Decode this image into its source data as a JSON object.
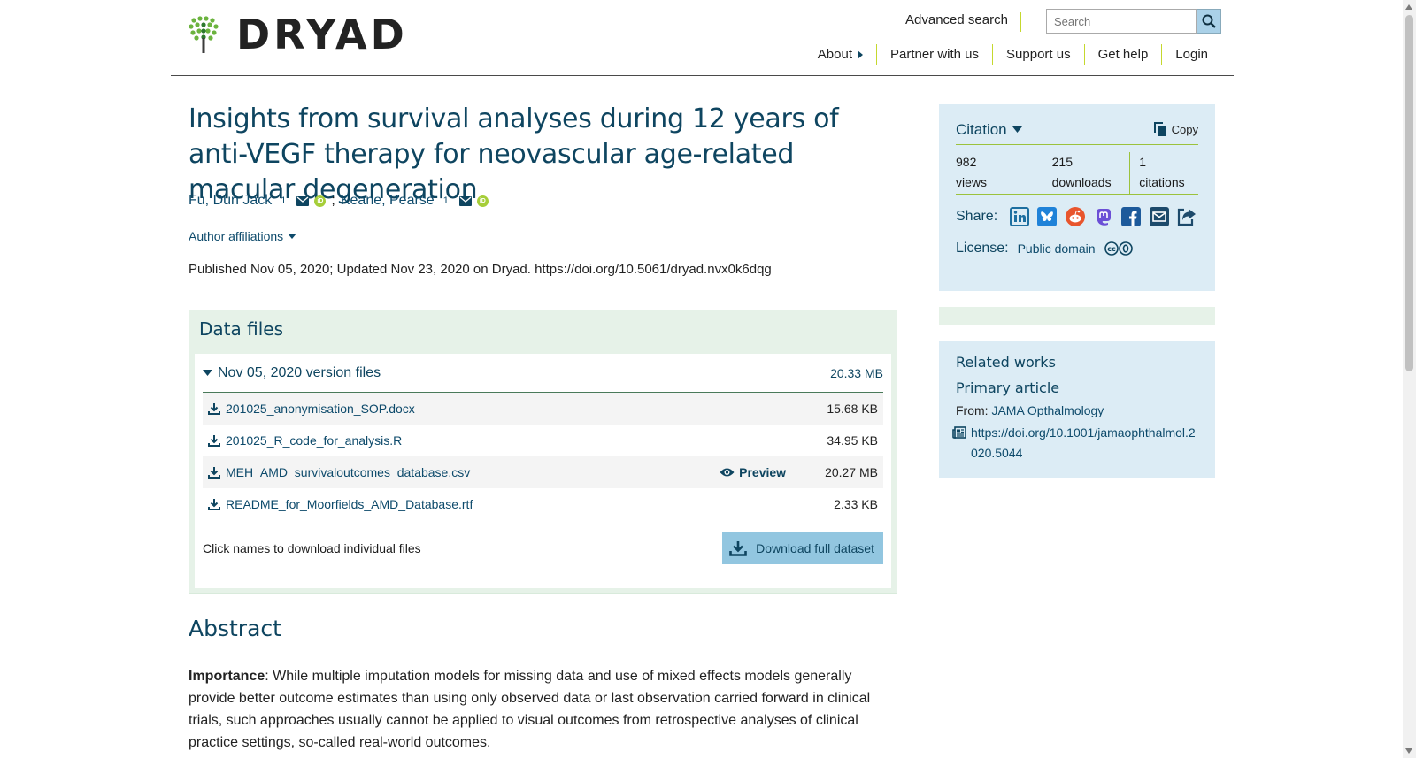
{
  "header": {
    "logo_text": "DRYAD",
    "advanced_search": "Advanced search",
    "search_placeholder": "Search",
    "nav": [
      "About",
      "Partner with us",
      "Support us",
      "Get help",
      "Login"
    ]
  },
  "dataset": {
    "title": "Insights from survival analyses during 12 years of anti-VEGF therapy for neovascular age-related macular degeneration",
    "authors": [
      {
        "name": "Fu, Dun Jack",
        "sup": "1"
      },
      {
        "name": "Keane, Pearse",
        "sup": "1"
      }
    ],
    "author_separator": ";",
    "affiliations_label": "Author affiliations",
    "published": "Published Nov 05, 2020; Updated Nov 23, 2020 on Dryad. https://doi.org/10.5061/dryad.nvx0k6dqg"
  },
  "data_files": {
    "heading": "Data files",
    "version_label": "Nov 05, 2020 version files",
    "version_size": "20.33 MB",
    "files": [
      {
        "name": "201025_anonymisation_SOP.docx",
        "size": "15.68 KB"
      },
      {
        "name": "201025_R_code_for_analysis.R",
        "size": "34.95 KB"
      },
      {
        "name": "MEH_AMD_survivaloutcomes_database.csv",
        "size": "20.27 MB",
        "preview": "Preview"
      },
      {
        "name": "README_for_Moorfields_AMD_Database.rtf",
        "size": "2.33 KB"
      }
    ],
    "hint": "Click names to download individual files",
    "download_button": "Download full dataset"
  },
  "abstract": {
    "heading": "Abstract",
    "lead": "Importance",
    "text": ": While multiple imputation models for missing data and use of mixed effects models generally provide better outcome estimates than using only observed data or last observation carried forward in clinical trials, such approaches usually cannot be applied to visual outcomes from retrospective analyses of clinical practice settings, so-called real-world outcomes."
  },
  "sidebar": {
    "citation_label": "Citation",
    "copy_label": "Copy",
    "metrics": [
      {
        "value": "982",
        "label": "views"
      },
      {
        "value": "215",
        "label": "downloads"
      },
      {
        "value": "1",
        "label": "citations"
      }
    ],
    "share_label": "Share:",
    "share_icons": [
      "linkedin-icon",
      "bluesky-icon",
      "reddit-icon",
      "mastodon-icon",
      "facebook-icon",
      "email-icon",
      "share-icon"
    ],
    "license_label": "License:",
    "license_value": "Public domain",
    "related": {
      "heading": "Related works",
      "subheading": "Primary article",
      "from_label": "From:",
      "from_value": "JAMA Opthalmology",
      "doi": "https://doi.org/10.1001/jamaophthalmol.2020.5044"
    }
  },
  "colors": {
    "accent": "#0e4560",
    "green_rule": "#9bc23c",
    "sidebar_bg": "#dcecf5",
    "data_bg": "#e6f2e8",
    "button_bg": "#92c6e0"
  }
}
